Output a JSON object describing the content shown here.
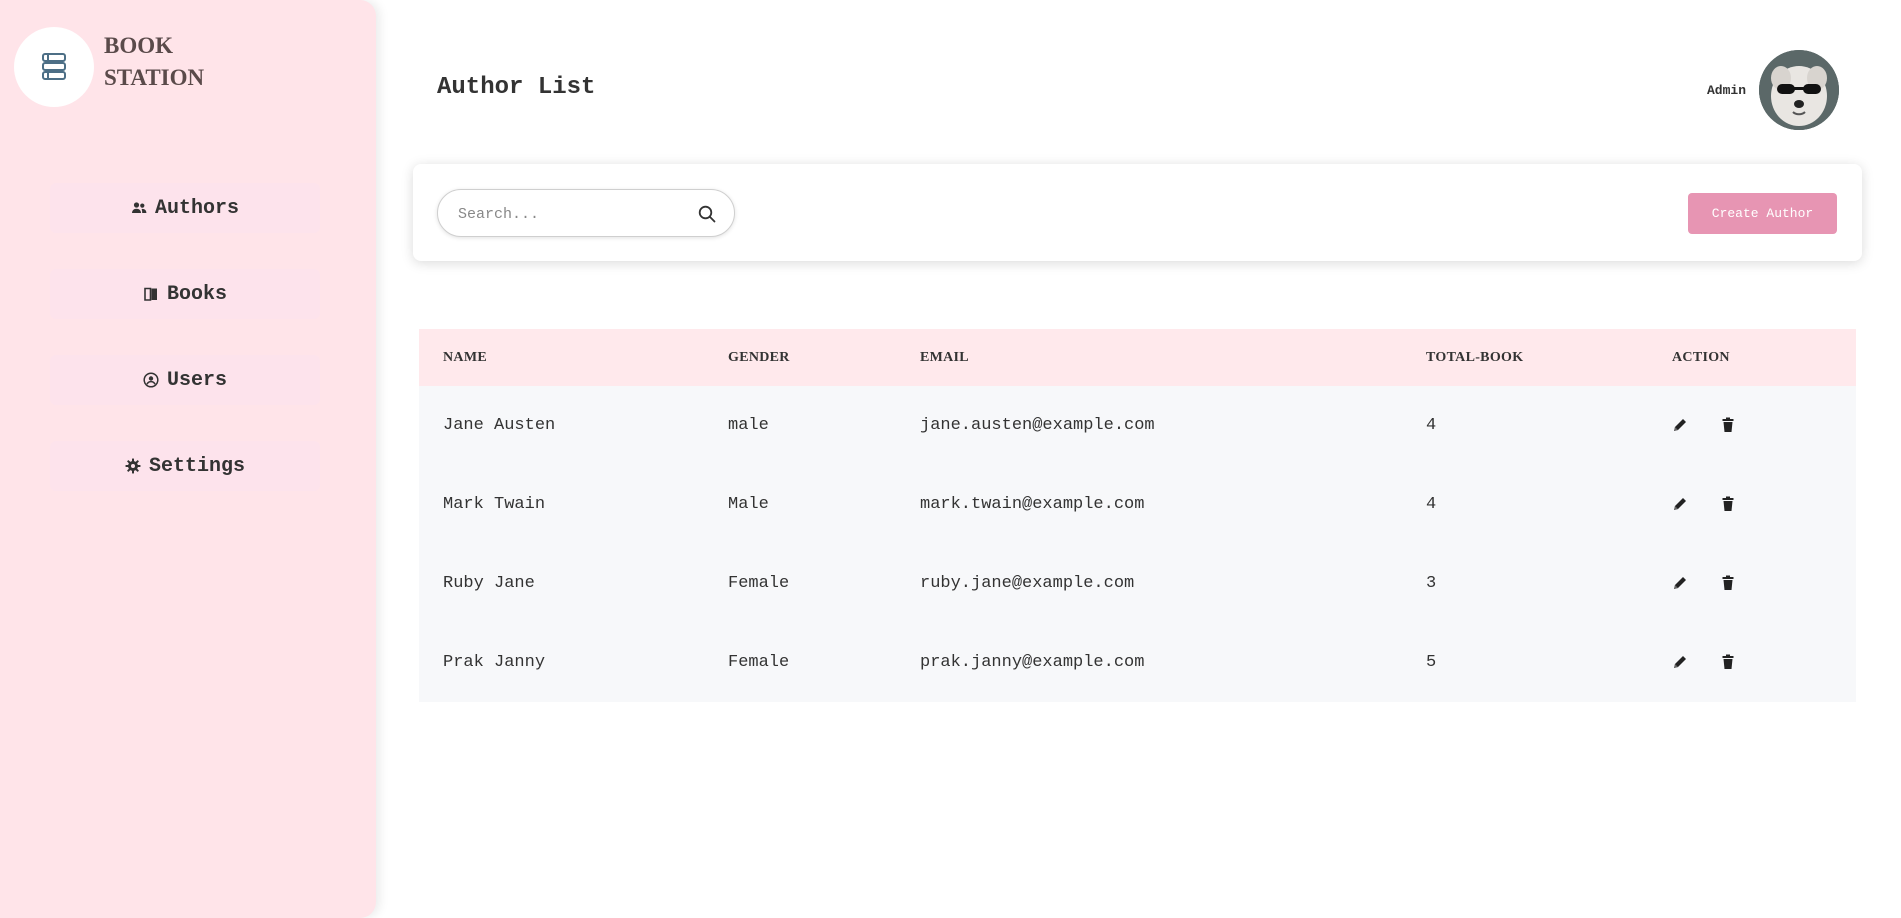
{
  "brand": {
    "line1": "BOOK",
    "line2": "STATION",
    "logo_icon": "books-stack-icon"
  },
  "sidebar": {
    "items": [
      {
        "label": "Authors",
        "icon": "users-icon"
      },
      {
        "label": "Books",
        "icon": "book-icon"
      },
      {
        "label": "Users",
        "icon": "user-circle-icon"
      },
      {
        "label": "Settings",
        "icon": "gear-icon"
      }
    ]
  },
  "header": {
    "title": "Author List",
    "user_label": "Admin"
  },
  "toolbar": {
    "search_placeholder": "Search...",
    "create_label": "Create Author"
  },
  "table": {
    "columns": [
      "NAME",
      "GENDER",
      "EMAIL",
      "TOTAL-BOOK",
      "ACTION"
    ],
    "rows": [
      {
        "name": "Jane Austen",
        "gender": "male",
        "email": "jane.austen@example.com",
        "total": "4"
      },
      {
        "name": "Mark Twain",
        "gender": "Male",
        "email": "mark.twain@example.com",
        "total": "4"
      },
      {
        "name": "Ruby Jane",
        "gender": "Female",
        "email": "ruby.jane@example.com",
        "total": "3"
      },
      {
        "name": "Prak Janny",
        "gender": "Female",
        "email": "prak.janny@example.com",
        "total": "5"
      }
    ]
  },
  "colors": {
    "sidebar_bg": "#ffe4e9",
    "accent": "#e795b3",
    "header_row": "#ffe9ec",
    "body_row": "#f7f8fa"
  }
}
